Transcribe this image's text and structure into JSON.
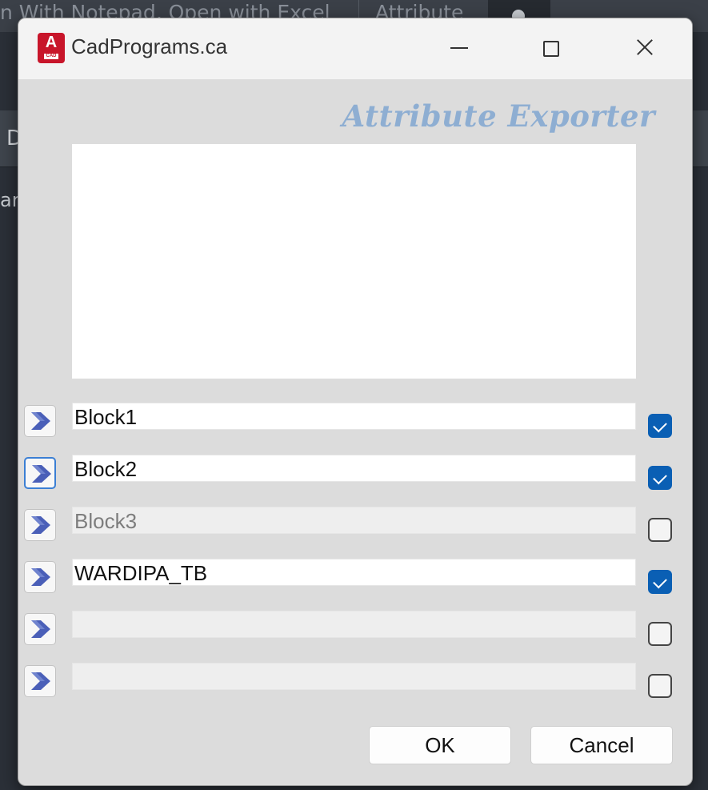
{
  "background": {
    "menu_text": "n With Notepad, Open with Excel",
    "tab_text": "Attribute",
    "side_letter_1": "D",
    "side_letter_2": "ar"
  },
  "window": {
    "title": "CadPrograms.ca",
    "icon_letter": "A",
    "icon_caption": "CAD",
    "controls": [
      "minimize",
      "maximize",
      "close"
    ]
  },
  "header": {
    "title": "Attribute Exporter",
    "title_color": "#8eaed2"
  },
  "rows": [
    {
      "value": "Block1",
      "checked": true,
      "enabled": true,
      "focused": false
    },
    {
      "value": "Block2",
      "checked": true,
      "enabled": true,
      "focused": true
    },
    {
      "value": "Block3",
      "checked": false,
      "enabled": false,
      "focused": false
    },
    {
      "value": "WARDIPA_TB",
      "checked": true,
      "enabled": true,
      "focused": false
    },
    {
      "value": "",
      "checked": false,
      "enabled": false,
      "focused": false
    },
    {
      "value": "",
      "checked": false,
      "enabled": false,
      "focused": false
    }
  ],
  "buttons": {
    "ok_label": "OK",
    "cancel_label": "Cancel"
  },
  "colors": {
    "accent": "#0a5fb4",
    "arrow": "#4a5fb8",
    "dialog_bg": "#dcdcdc"
  }
}
